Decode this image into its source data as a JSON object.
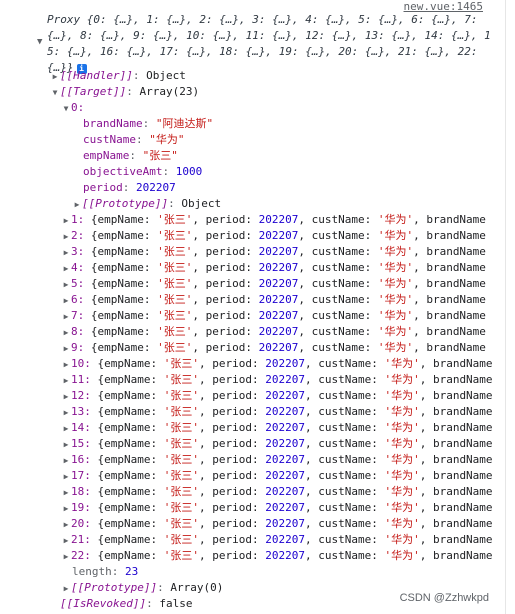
{
  "source_link": "new.vue:1465",
  "summary": {
    "text": "Proxy {0: {…}, 1: {…}, 2: {…}, 3: {…}, 4: {…}, 5: {…}, 6: {…}, 7: {…}, 8: {…}, 9: {…}, 10: {…}, 11: {…}, 12: {…}, 13: {…}, 14: {…}, 15: {…}, 16: {…}, 17: {…}, 18: {…}, 19: {…}, 20: {…}, 21: {…}, 22: {…}}",
    "info_badge": "i"
  },
  "handler": {
    "key": "[[Handler]]",
    "value": "Object"
  },
  "target": {
    "key": "[[Target]]",
    "value": "Array(23)"
  },
  "item0": {
    "index": "0:",
    "fields": [
      {
        "key": "brandName",
        "value": "\"阿迪达斯\"",
        "type": "str"
      },
      {
        "key": "custName",
        "value": "\"华为\"",
        "type": "str"
      },
      {
        "key": "empName",
        "value": "\"张三\"",
        "type": "str"
      },
      {
        "key": "objectiveAmt",
        "value": "1000",
        "type": "num"
      },
      {
        "key": "period",
        "value": "202207",
        "type": "num"
      }
    ],
    "prototype": {
      "key": "[[Prototype]]",
      "value": "Object"
    }
  },
  "items": [
    {
      "index": "1:"
    },
    {
      "index": "2:"
    },
    {
      "index": "3:"
    },
    {
      "index": "4:"
    },
    {
      "index": "5:"
    },
    {
      "index": "6:"
    },
    {
      "index": "7:"
    },
    {
      "index": "8:"
    },
    {
      "index": "9:"
    },
    {
      "index": "10:"
    },
    {
      "index": "11:"
    },
    {
      "index": "12:"
    },
    {
      "index": "13:"
    },
    {
      "index": "14:"
    },
    {
      "index": "15:"
    },
    {
      "index": "16:"
    },
    {
      "index": "17:"
    },
    {
      "index": "18:"
    },
    {
      "index": "19:"
    },
    {
      "index": "20:"
    },
    {
      "index": "21:"
    },
    {
      "index": "22:"
    }
  ],
  "item_preview": {
    "open": "{empName: ",
    "emp": "'张三'",
    "sep1": ", period: ",
    "period": "202207",
    "sep2": ", custName: ",
    "cust": "'华为'",
    "sep3": ", brandName",
    "ellipsis": "…"
  },
  "length": {
    "key": "length",
    "value": "23"
  },
  "array_prototype": {
    "key": "[[Prototype]]",
    "value": "Array(0)"
  },
  "is_revoked": {
    "key": "[[IsRevoked]]",
    "value": "false"
  },
  "watermark": "CSDN @Zzhwkpd"
}
